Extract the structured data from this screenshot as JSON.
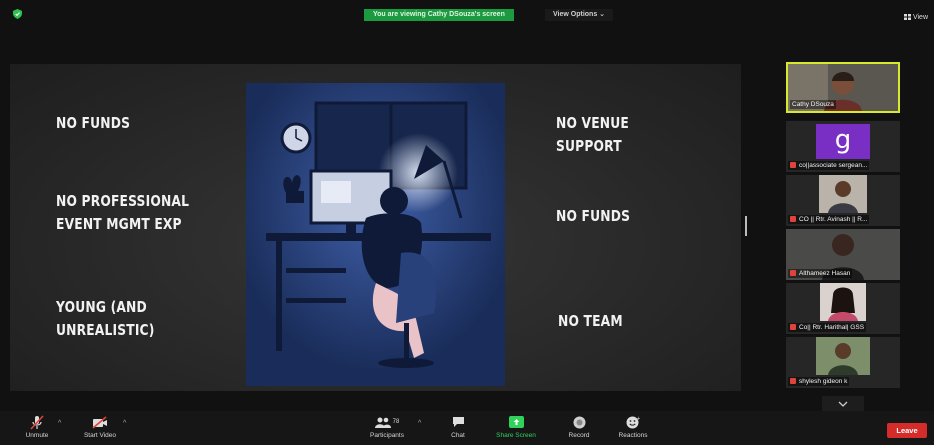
{
  "top_bar": {
    "viewing_banner": "You are viewing Cathy DSouza's screen",
    "view_options": "View Options ⌄",
    "view_button": "View"
  },
  "slide": {
    "left_items": [
      "NO FUNDS",
      "NO PROFESSIONAL\nEVENT MGMT EXP",
      "YOUNG (AND\nUNREALISTIC)"
    ],
    "right_items": [
      "NO VENUE\nSUPPORT",
      "NO FUNDS",
      "NO TEAM"
    ]
  },
  "participants": [
    {
      "name": "Cathy DSouza",
      "active": true,
      "muted": false
    },
    {
      "name": "co||associate sergean...",
      "initial": "g",
      "muted": true
    },
    {
      "name": "CO || Rtr. Avinash || R...",
      "muted": true
    },
    {
      "name": "Althameez Hasan",
      "muted": true
    },
    {
      "name": "Co|| Rtr. Harithal| GSS",
      "muted": true
    },
    {
      "name": "shylesh gideon k",
      "muted": true
    }
  ],
  "toolbar": {
    "unmute": "Unmute",
    "start_video": "Start Video",
    "participants": "Participants",
    "participants_count": "78",
    "chat": "Chat",
    "share_screen": "Share Screen",
    "record": "Record",
    "reactions": "Reactions",
    "leave": "Leave"
  },
  "colors": {
    "share_green": "#1c9a3f",
    "active_border": "#d8e82a",
    "leave_red": "#d42b2b",
    "art_blue": "#223a6e"
  }
}
